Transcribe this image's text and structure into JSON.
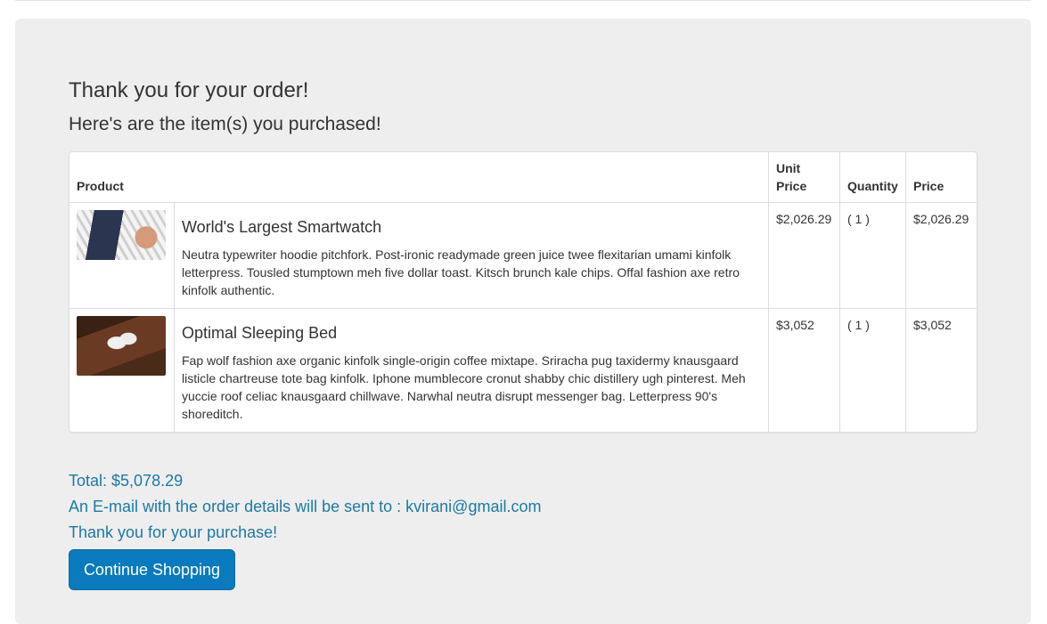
{
  "heading": "Thank you for your order!",
  "subheading": "Here's are the item(s) you purchased!",
  "table": {
    "headers": {
      "product": "Product",
      "unit_price": "Unit Price",
      "quantity": "Quantity",
      "price": "Price"
    },
    "rows": [
      {
        "name": "World's Largest Smartwatch",
        "description": "Neutra typewriter hoodie pitchfork. Post-ironic readymade green juice twee flexitarian umami kinfolk letterpress. Tousled stumptown meh five dollar toast. Kitsch brunch kale chips. Offal fashion axe retro kinfolk authentic.",
        "unit_price": "$2,026.29",
        "quantity": "( 1 )",
        "price": "$2,026.29",
        "image_icon": "smartwatch-photo"
      },
      {
        "name": "Optimal Sleeping Bed",
        "description": "Fap wolf fashion axe organic kinfolk single-origin coffee mixtape. Sriracha pug taxidermy knausgaard listicle chartreuse tote bag kinfolk. Iphone mumblecore cronut shabby chic distillery ugh pinterest. Meh yuccie roof celiac knausgaard chillwave. Narwhal neutra disrupt messenger bag. Letterpress 90's shoreditch.",
        "unit_price": "$3,052",
        "quantity": "( 1 )",
        "price": "$3,052",
        "image_icon": "bed-photo"
      }
    ]
  },
  "summary": {
    "total": "Total: $5,078.29",
    "email_notice": "An E-mail with the order details will be sent to : kvirani@gmail.com",
    "thanks": "Thank you for your purchase!"
  },
  "continue_button": "Continue Shopping",
  "colors": {
    "jumbotron_bg": "#eeeeee",
    "summary_text": "#1a7aa8",
    "button_bg": "#0a7abf"
  }
}
